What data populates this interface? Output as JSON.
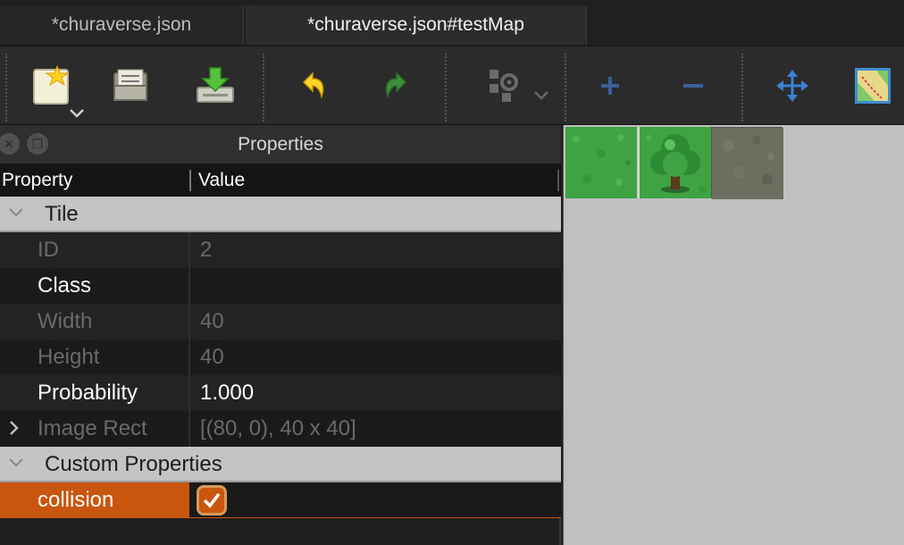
{
  "tabs": [
    {
      "label": "*churaverse.json"
    },
    {
      "label": "*churaverse.json#testMap"
    }
  ],
  "toolbar": {
    "buttons": [
      {
        "name": "new-tileset-icon"
      },
      {
        "name": "open-folder-icon"
      },
      {
        "name": "save-download-icon"
      },
      {
        "name": "undo-icon"
      },
      {
        "name": "redo-icon"
      },
      {
        "name": "tile-settings-icon"
      },
      {
        "name": "add-icon"
      },
      {
        "name": "remove-icon"
      },
      {
        "name": "move-icon"
      },
      {
        "name": "terrain-map-icon"
      }
    ]
  },
  "properties_panel": {
    "title": "Properties",
    "columns": {
      "property": "Property",
      "value": "Value"
    },
    "groups": [
      {
        "label": "Tile",
        "rows": [
          {
            "name": "ID",
            "value": "2",
            "editable": false
          },
          {
            "name": "Class",
            "value": "",
            "editable": true
          },
          {
            "name": "Width",
            "value": "40",
            "editable": false
          },
          {
            "name": "Height",
            "value": "40",
            "editable": false
          },
          {
            "name": "Probability",
            "value": "1.000",
            "editable": true
          },
          {
            "name": "Image Rect",
            "value": "[(80, 0), 40 x 40]",
            "editable": false
          }
        ]
      },
      {
        "label": "Custom Properties",
        "rows": [
          {
            "name": "collision",
            "value": true,
            "selected": true
          }
        ]
      }
    ]
  },
  "colors": {
    "selection": "#c8560f",
    "group_bg": "#c4c4c4",
    "tileset_bg": "#c0c0c0"
  },
  "tileset": {
    "tiles": [
      {
        "name": "grass-tile"
      },
      {
        "name": "tree-tile"
      },
      {
        "name": "stone-tile",
        "selected": true
      }
    ]
  }
}
